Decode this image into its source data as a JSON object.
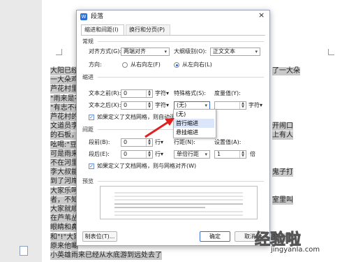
{
  "doc_lines_left": [
    "大阳已经升",
    "一大朵鸡头",
    "芦花村里",
    "\"雨来是不",
    "\"有志不在",
    "芦花村的",
    "文道员李大",
    "的石板，",
    "吆喝:\"豆腐",
    "可是雨来",
    "不在河里",
    "李大叔能",
    "到了河岸",
    "大家乐呵",
    "者，不知",
    "大家就顺着",
    "在芦苇丛里",
    "眼睛和鼻子",
    "和\"!\"大家",
    "原来他唰",
    "小英雄雨来已经从水底游到远处去了"
  ],
  "doc_lines_right": [
    "了一大朵",
    "",
    "",
    "",
    "",
    "",
    "开闹口",
    "上有人",
    "",
    "",
    "",
    "鬼子打",
    "",
    "",
    "室里叫",
    "",
    "",
    "",
    "抹一下",
    "",
    ""
  ],
  "dialog": {
    "title": "段落",
    "close": "×",
    "tabs": [
      "缩进和间距(I)",
      "换行和分页(P)"
    ],
    "general": {
      "section": "常规",
      "align_label": "对齐方式(G):",
      "align_value": "两端对齐",
      "outline_label": "大纲级别(O):",
      "outline_value": "正文文本",
      "direction_label": "方向:",
      "dir_rtl": "从右向左(F)",
      "dir_ltr": "从左向右(L)"
    },
    "indent": {
      "section": "缩进",
      "before_label": "文本之前(R):",
      "before_value": "0",
      "before_unit": "字符▾",
      "special_label": "特殊格式(S):",
      "special_value": "(无)",
      "measure_label": "度量值(Y):",
      "measure_unit": "字符▾",
      "after_label": "文本之后(X):",
      "after_value": "0",
      "after_unit": "字符▾",
      "grid_check": "如果定义了文档网格，则自动调整"
    },
    "dropdown_options": [
      "(无)",
      "首行缩进",
      "悬挂缩进"
    ],
    "spacing": {
      "section": "间距",
      "before_label": "段前(B):",
      "before_value": "0",
      "before_unit": "行▾",
      "linespacing_label": "行距(N):",
      "linespacing_value": "单倍行距",
      "setvalue_label": "设置值(A):",
      "setvalue_value": "1",
      "setvalue_unit": "倍",
      "after_label": "段后(E):",
      "after_value": "0",
      "after_unit": "行▾",
      "grid_check": "如果定义了文档网格，则与网格对齐(W)"
    },
    "preview": {
      "section": "预览"
    },
    "buttons": {
      "tabs": "制表位(T)...",
      "ok": "确定",
      "cancel": "取消"
    }
  },
  "watermark": {
    "text": "经验啦",
    "url": "jingyanla.com"
  }
}
